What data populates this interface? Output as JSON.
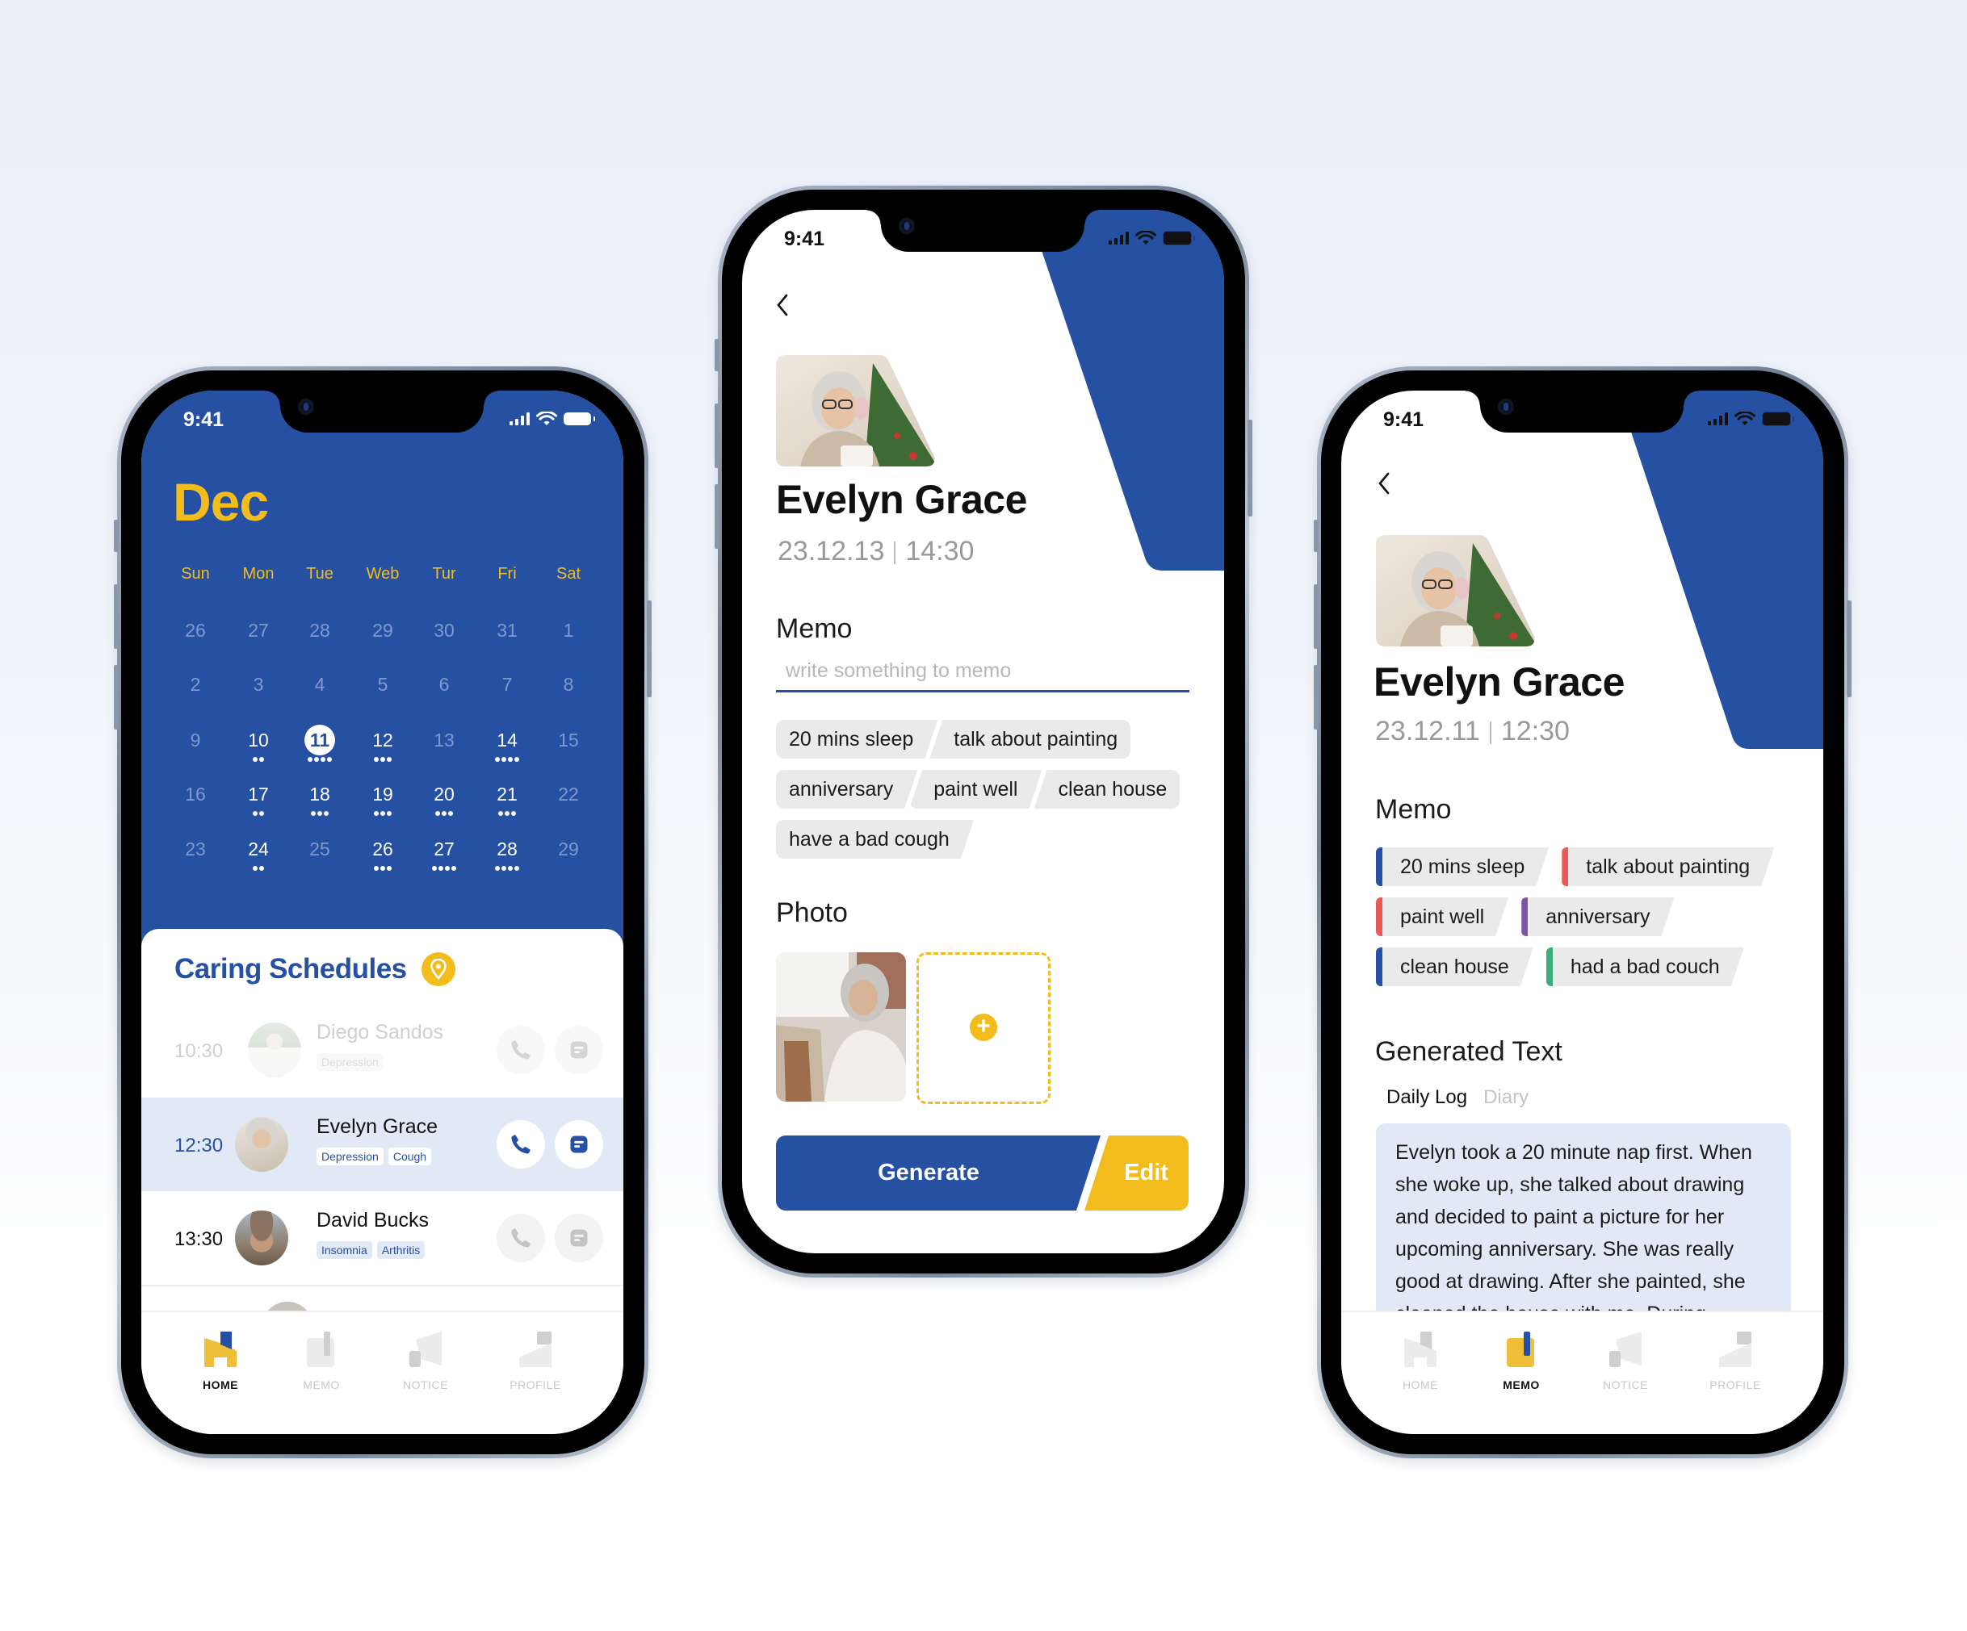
{
  "status_bar": {
    "time": "9:41"
  },
  "colors": {
    "primary_blue": "#2650a2",
    "accent_yellow": "#f2bd1c",
    "highlight": "#e1e8f6",
    "chip_gray": "#eaeaea"
  },
  "home_screen": {
    "month": "Dec",
    "weekdays": [
      "Sun",
      "Mon",
      "Tue",
      "Web",
      "Tur",
      "Fri",
      "Sat"
    ],
    "weeks": [
      [
        {
          "d": "26",
          "muted": true,
          "dots": 0
        },
        {
          "d": "27",
          "muted": true,
          "dots": 0
        },
        {
          "d": "28",
          "muted": true,
          "dots": 0
        },
        {
          "d": "29",
          "muted": true,
          "dots": 0
        },
        {
          "d": "30",
          "muted": true,
          "dots": 0
        },
        {
          "d": "31",
          "muted": true,
          "dots": 0
        },
        {
          "d": "1",
          "muted": true,
          "dots": 0
        }
      ],
      [
        {
          "d": "2",
          "muted": true,
          "dots": 0
        },
        {
          "d": "3",
          "muted": true,
          "dots": 0
        },
        {
          "d": "4",
          "muted": true,
          "dots": 0
        },
        {
          "d": "5",
          "muted": true,
          "dots": 0
        },
        {
          "d": "6",
          "muted": true,
          "dots": 0
        },
        {
          "d": "7",
          "muted": true,
          "dots": 0
        },
        {
          "d": "8",
          "muted": true,
          "dots": 0
        }
      ],
      [
        {
          "d": "9",
          "muted": true,
          "dots": 0
        },
        {
          "d": "10",
          "muted": false,
          "dots": 2
        },
        {
          "d": "11",
          "muted": false,
          "dots": 4,
          "today": true
        },
        {
          "d": "12",
          "muted": false,
          "dots": 3
        },
        {
          "d": "13",
          "muted": true,
          "dots": 0
        },
        {
          "d": "14",
          "muted": false,
          "dots": 4
        },
        {
          "d": "15",
          "muted": true,
          "dots": 0
        }
      ],
      [
        {
          "d": "16",
          "muted": true,
          "dots": 0
        },
        {
          "d": "17",
          "muted": false,
          "dots": 2
        },
        {
          "d": "18",
          "muted": false,
          "dots": 3
        },
        {
          "d": "19",
          "muted": false,
          "dots": 3
        },
        {
          "d": "20",
          "muted": false,
          "dots": 3
        },
        {
          "d": "21",
          "muted": false,
          "dots": 3
        },
        {
          "d": "22",
          "muted": true,
          "dots": 0
        }
      ],
      [
        {
          "d": "23",
          "muted": true,
          "dots": 0
        },
        {
          "d": "24",
          "muted": false,
          "dots": 2
        },
        {
          "d": "25",
          "muted": true,
          "dots": 0
        },
        {
          "d": "26",
          "muted": false,
          "dots": 3
        },
        {
          "d": "27",
          "muted": false,
          "dots": 4
        },
        {
          "d": "28",
          "muted": false,
          "dots": 4
        },
        {
          "d": "29",
          "muted": true,
          "dots": 0
        }
      ]
    ],
    "schedules_title": "Caring Schedules",
    "schedules": [
      {
        "time": "10:30",
        "name": "Diego Sandos",
        "tags": [
          "Depression"
        ],
        "state": "past"
      },
      {
        "time": "12:30",
        "name": "Evelyn Grace",
        "tags": [
          "Depression",
          "Cough"
        ],
        "state": "current"
      },
      {
        "time": "13:30",
        "name": "David Bucks",
        "tags": [
          "Insomnia",
          "Arthritis"
        ],
        "state": "upcoming"
      }
    ]
  },
  "tabs": [
    "HOME",
    "MEMO",
    "NOTICE",
    "PROFILE"
  ],
  "memo_screen": {
    "name": "Evelyn Grace",
    "date": "23.12.13",
    "time": "14:30",
    "memo_label": "Memo",
    "memo_placeholder": "write something to memo",
    "memo_value": "",
    "chips": [
      "20 mins sleep",
      "talk about painting",
      "anniversary",
      "paint well",
      "clean house",
      "have a bad cough"
    ],
    "photo_label": "Photo",
    "generate_label": "Generate",
    "edit_label": "Edit"
  },
  "result_screen": {
    "name": "Evelyn Grace",
    "date": "23.12.11",
    "time": "12:30",
    "memo_label": "Memo",
    "chips": [
      {
        "text": "20 mins sleep",
        "color": "#2650a2"
      },
      {
        "text": "talk about painting",
        "color": "#e85a5a"
      },
      {
        "text": "paint well",
        "color": "#e85a5a"
      },
      {
        "text": "anniversary",
        "color": "#7a55a8"
      },
      {
        "text": "clean house",
        "color": "#2650a2"
      },
      {
        "text": "had a bad couch",
        "color": "#3bb07a"
      }
    ],
    "generated_label": "Generated Text",
    "gen_tabs": [
      "Daily Log",
      "Diary"
    ],
    "generated_text": "Evelyn took a 20 minute nap first. When she woke up, she talked about drawing and decided to paint a picture for her upcoming anniversary. She was really good at drawing. After she painted, she cleaned the house with me. During"
  }
}
